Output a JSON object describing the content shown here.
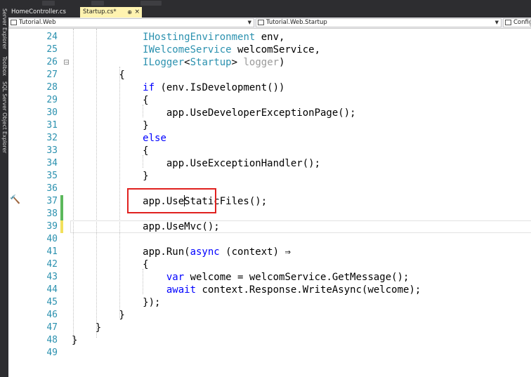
{
  "sidebar": {
    "items": [
      "Server Explorer",
      "Toolbox",
      "SQL Server Object Explorer"
    ]
  },
  "tabs": [
    {
      "label": "HomeController.cs",
      "active": false
    },
    {
      "label": "Startup.cs*",
      "active": true,
      "pin": "⊕",
      "close": "×"
    }
  ],
  "navbar": {
    "project": "Tutorial.Web",
    "class": "Tutorial.Web.Startup",
    "member": "Config"
  },
  "colors": {
    "keyword": "#0000ff",
    "type": "#2b91af",
    "line_number": "#2b91af",
    "grayed": "#9a9a9a",
    "highlight_box": "#e0211f",
    "change_saved": "#5cb85c",
    "change_unsaved": "#f2e05c"
  },
  "code": {
    "lines": [
      {
        "n": "24",
        "segs": [
          {
            "t": "            "
          },
          {
            "t": "IHostingEnvironment",
            "c": "ty"
          },
          {
            "t": " env,"
          }
        ]
      },
      {
        "n": "25",
        "segs": [
          {
            "t": "            "
          },
          {
            "t": "IWelcomeService",
            "c": "ty"
          },
          {
            "t": " welcomService,"
          }
        ]
      },
      {
        "n": "26",
        "segs": [
          {
            "t": "            "
          },
          {
            "t": "ILogger",
            "c": "ty"
          },
          {
            "t": "<"
          },
          {
            "t": "Startup",
            "c": "ty"
          },
          {
            "t": "> "
          },
          {
            "t": "logger",
            "c": "gr"
          },
          {
            "t": ")"
          }
        ]
      },
      {
        "n": "27",
        "segs": [
          {
            "t": "        {"
          }
        ]
      },
      {
        "n": "28",
        "segs": [
          {
            "t": "            "
          },
          {
            "t": "if",
            "c": "kw"
          },
          {
            "t": " (env.IsDevelopment())"
          }
        ]
      },
      {
        "n": "29",
        "segs": [
          {
            "t": "            {"
          }
        ]
      },
      {
        "n": "30",
        "segs": [
          {
            "t": "                app.UseDeveloperExceptionPage();"
          }
        ]
      },
      {
        "n": "31",
        "segs": [
          {
            "t": "            }"
          }
        ]
      },
      {
        "n": "32",
        "segs": [
          {
            "t": "            "
          },
          {
            "t": "else",
            "c": "kw"
          }
        ]
      },
      {
        "n": "33",
        "segs": [
          {
            "t": "            {"
          }
        ]
      },
      {
        "n": "34",
        "segs": [
          {
            "t": "                app.UseExceptionHandler();"
          }
        ]
      },
      {
        "n": "35",
        "segs": [
          {
            "t": "            }"
          }
        ]
      },
      {
        "n": "36",
        "segs": []
      },
      {
        "n": "37",
        "segs": [
          {
            "t": "            app.UseStaticFiles();"
          }
        ]
      },
      {
        "n": "38",
        "segs": []
      },
      {
        "n": "39",
        "segs": [
          {
            "t": "            app.UseMvc();"
          }
        ]
      },
      {
        "n": "40",
        "segs": []
      },
      {
        "n": "41",
        "segs": [
          {
            "t": "            app.Run("
          },
          {
            "t": "async",
            "c": "kw"
          },
          {
            "t": " (context) ⇒"
          }
        ]
      },
      {
        "n": "42",
        "segs": [
          {
            "t": "            {"
          }
        ]
      },
      {
        "n": "43",
        "segs": [
          {
            "t": "                "
          },
          {
            "t": "var",
            "c": "kw"
          },
          {
            "t": " welcome = welcomService.GetMessage();"
          }
        ]
      },
      {
        "n": "44",
        "segs": [
          {
            "t": "                "
          },
          {
            "t": "await",
            "c": "kw"
          },
          {
            "t": " context.Response.WriteAsync(welcome);"
          }
        ]
      },
      {
        "n": "45",
        "segs": [
          {
            "t": "            });"
          }
        ]
      },
      {
        "n": "46",
        "segs": [
          {
            "t": "        }"
          }
        ]
      },
      {
        "n": "47",
        "segs": [
          {
            "t": "    }"
          }
        ]
      },
      {
        "n": "48",
        "segs": [
          {
            "t": "}"
          }
        ]
      },
      {
        "n": "49",
        "segs": []
      }
    ]
  }
}
